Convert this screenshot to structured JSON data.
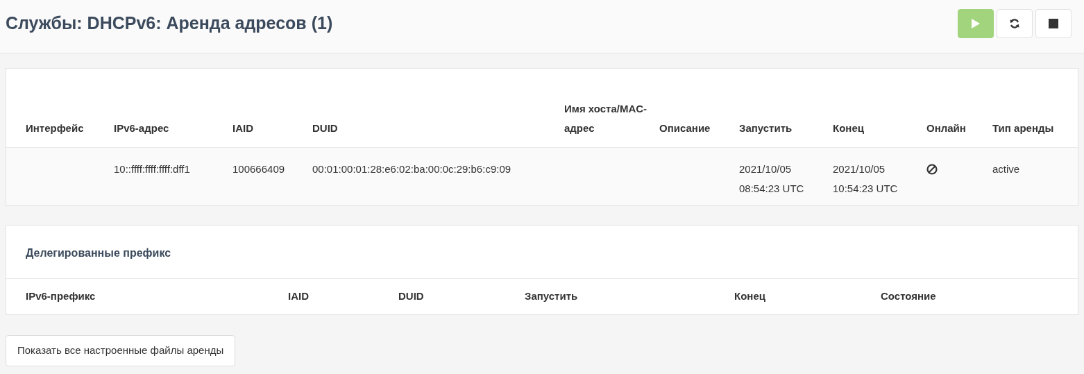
{
  "title": "Службы: DHCPv6: Аренда адресов (1)",
  "toolbar": [
    {
      "kind": "start"
    },
    {
      "kind": "restart"
    },
    {
      "kind": "stop"
    }
  ],
  "leases": {
    "columns": [
      "Интерфейс",
      "IPv6-адрес",
      "IAID",
      "DUID",
      "Имя хоста/MAC-адрес",
      "Описание",
      "Запустить",
      "Конец",
      "Онлайн",
      "Тип аренды"
    ],
    "rows": [
      {
        "interface": "",
        "address": "10::ffff:ffff:ffff:dff1",
        "iaid": "100666409",
        "duid": "00:01:00:01:28:e6:02:ba:00:0c:29:b6:c9:09",
        "hostname": "",
        "description": "",
        "start": [
          "2021/10/05",
          "08:54:23 UTC"
        ],
        "end": [
          "2021/10/05",
          "10:54:23 UTC"
        ],
        "online": false,
        "type": "active"
      }
    ]
  },
  "prefixes": {
    "title": "Делегированные префикс",
    "columns": [
      "IPv6-префикс",
      "IAID",
      "DUID",
      "Запустить",
      "Конец",
      "Состояние"
    ]
  },
  "show_all_button": "Показать все настроенные файлы аренды"
}
